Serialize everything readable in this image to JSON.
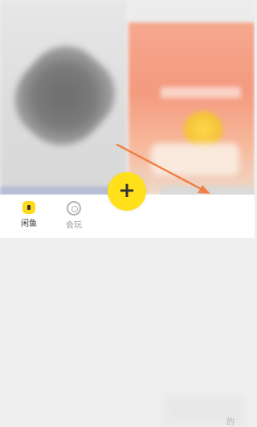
{
  "feed": {
    "left_card_caption": "",
    "right_card_caption": ""
  },
  "tabbar": {
    "home_label": "闲鱼",
    "play_label": "会玩",
    "publish_glyph": "+",
    "mine_label_partial": "的"
  },
  "colors": {
    "accent_yellow": "#ffe01a",
    "annotation_arrow": "#f07a3a"
  },
  "icons": {
    "home": "fish-home-icon",
    "play": "play-circle-icon",
    "publish": "plus-icon"
  }
}
